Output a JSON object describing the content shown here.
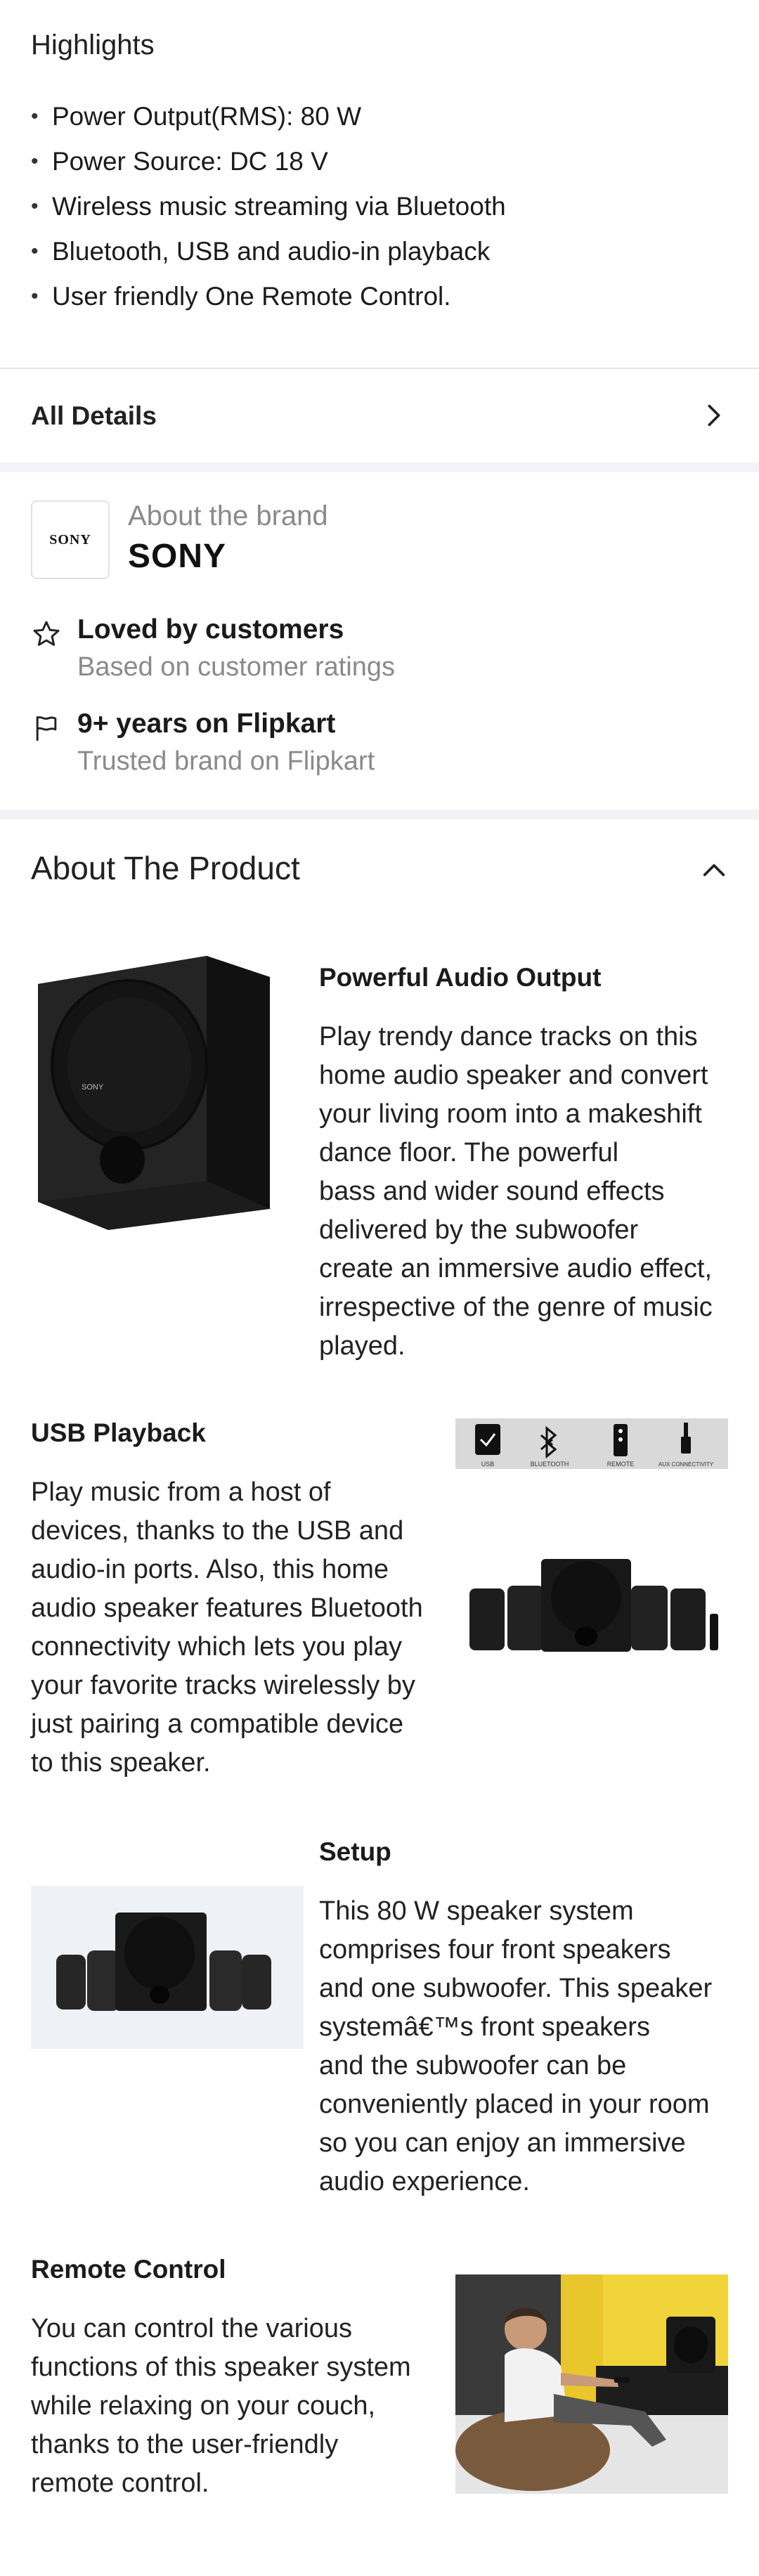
{
  "highlights": {
    "title": "Highlights",
    "items": [
      "Power Output(RMS): 80 W",
      "Power Source: DC 18 V",
      "Wireless music streaming via Bluetooth",
      "Bluetooth, USB and audio-in playback",
      "User friendly One Remote Control."
    ]
  },
  "all_details": {
    "label": "All Details"
  },
  "brand": {
    "logo_text": "SONY",
    "subtitle": "About the brand",
    "name": "SONY",
    "loved": {
      "title": "Loved by customers",
      "subtitle": "Based on customer ratings"
    },
    "years": {
      "title": "9+ years on Flipkart",
      "subtitle": "Trusted brand on Flipkart"
    }
  },
  "about": {
    "title": "About The Product",
    "features": [
      {
        "title": "Powerful Audio Output",
        "text": "Play trendy dance tracks on this\nhome audio speaker and convert\nyour living room into a makeshift\ndance floor. The powerful\nbass and wider sound effects\ndelivered by the subwoofer\ncreate an immersive audio effect,\nirrespective of the genre of music\nplayed."
      },
      {
        "title": "USB Playback",
        "text": "Play music from a host of\ndevices, thanks to the USB and\naudio-in ports. Also, this home\naudio speaker features Bluetooth\nconnectivity which lets you play\nyour favorite tracks wirelessly by\njust pairing a compatible device\nto this speaker.",
        "icon_labels": [
          "USB",
          "BLUETOOTH",
          "REMOTE",
          "AUX CONNECTIVITY"
        ]
      },
      {
        "title": "Setup",
        "text": "This 80 W speaker system\ncomprises four front speakers\nand one subwoofer. This speaker\nsystemâ€™s front speakers\nand the subwoofer can be\nconveniently placed in your room\nso you can enjoy an immersive\naudio experience."
      },
      {
        "title": "Remote Control",
        "text": "You can control the various\nfunctions of this speaker system\nwhile relaxing on your couch,\nthanks to the user-friendly\nremote control."
      }
    ],
    "product_badge": "SONY"
  }
}
